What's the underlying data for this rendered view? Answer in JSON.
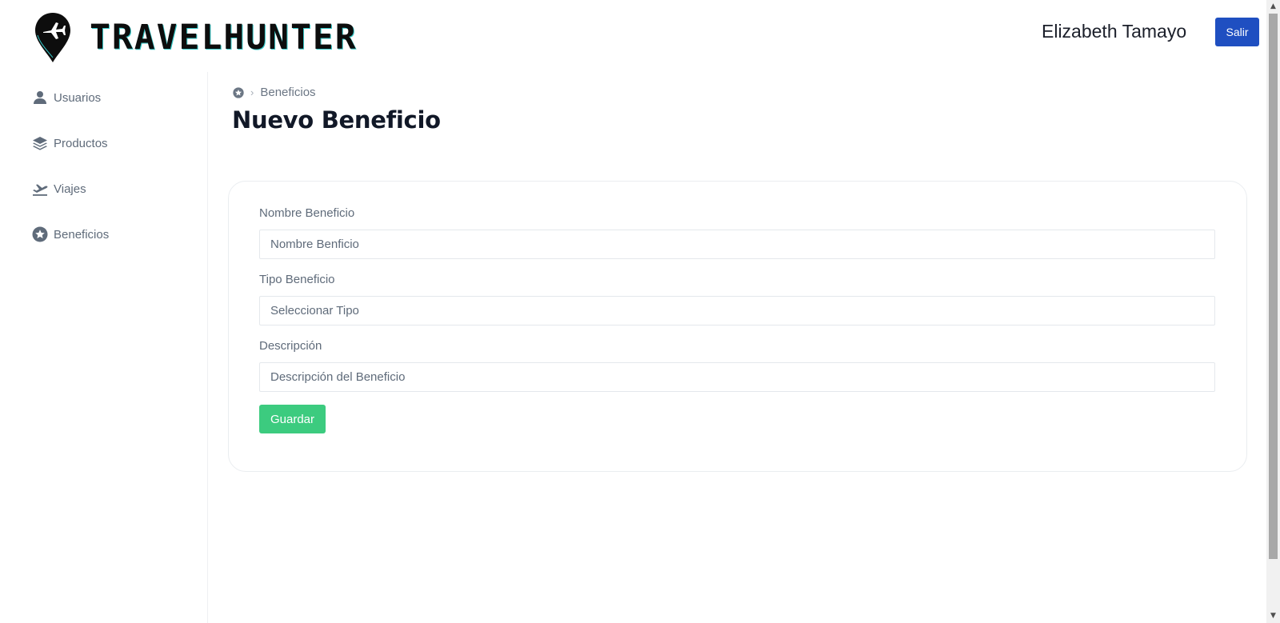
{
  "header": {
    "brand": "TRAVELHUNTER",
    "user_name": "Elizabeth Tamayo",
    "logout_label": "Salir"
  },
  "sidebar": {
    "items": [
      {
        "label": "Usuarios",
        "icon": "user-icon"
      },
      {
        "label": "Productos",
        "icon": "layers-icon"
      },
      {
        "label": "Viajes",
        "icon": "plane-departure-icon"
      },
      {
        "label": "Beneficios",
        "icon": "star-circle-icon"
      }
    ]
  },
  "breadcrumb": {
    "home_icon": "star-circle-icon",
    "current": "Beneficios"
  },
  "page": {
    "title": "Nuevo Beneficio"
  },
  "form": {
    "name_label": "Nombre Beneficio",
    "name_placeholder": "Nombre Benficio",
    "name_value": "",
    "type_label": "Tipo Beneficio",
    "type_placeholder": "Seleccionar Tipo",
    "type_value": "",
    "desc_label": "Descripción",
    "desc_placeholder": "Descripción del Beneficio",
    "desc_value": "",
    "save_label": "Guardar"
  },
  "colors": {
    "primary": "#1f4fc1",
    "success": "#3ccb7f",
    "brand_accent": "#33c7c7",
    "title": "#111827"
  }
}
